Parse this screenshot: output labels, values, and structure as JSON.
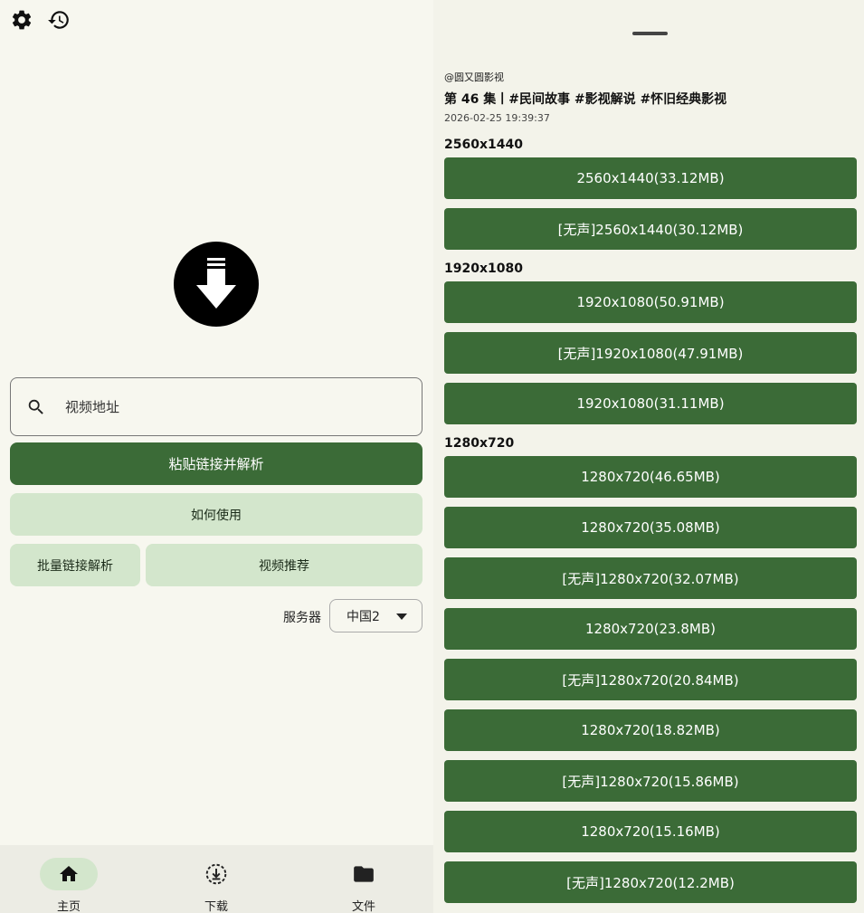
{
  "toolbar": {
    "settings_icon": "gear-icon",
    "history_icon": "history-icon"
  },
  "search": {
    "placeholder": "视频地址",
    "value": ""
  },
  "buttons": {
    "paste_parse": "粘贴链接并解析",
    "how_to_use": "如何使用",
    "batch_parse": "批量链接解析",
    "recommend": "视频推荐"
  },
  "server": {
    "label": "服务器",
    "selected": "中国2"
  },
  "nav": {
    "home": "主页",
    "download": "下载",
    "files": "文件"
  },
  "video": {
    "author": "@圆又圆影视",
    "title": "第 46 集丨#民间故事 #影视解说 #怀旧经典影视",
    "datetime": "2026-02-25 19:39:37"
  },
  "sections": [
    {
      "heading": "2560x1440",
      "options": [
        "2560x1440(33.12MB)",
        "[无声]2560x1440(30.12MB)"
      ]
    },
    {
      "heading": "1920x1080",
      "options": [
        "1920x1080(50.91MB)",
        "[无声]1920x1080(47.91MB)",
        "1920x1080(31.11MB)"
      ]
    },
    {
      "heading": "1280x720",
      "options": [
        "1280x720(46.65MB)",
        "1280x720(35.08MB)",
        "[无声]1280x720(32.07MB)",
        "1280x720(23.8MB)",
        "[无声]1280x720(20.84MB)",
        "1280x720(18.82MB)",
        "[无声]1280x720(15.86MB)",
        "1280x720(15.16MB)",
        "[无声]1280x720(12.2MB)"
      ]
    }
  ],
  "colors": {
    "primary": "#3b6b37",
    "tonal": "#d3e6cc",
    "background": "#f7f7ef"
  }
}
